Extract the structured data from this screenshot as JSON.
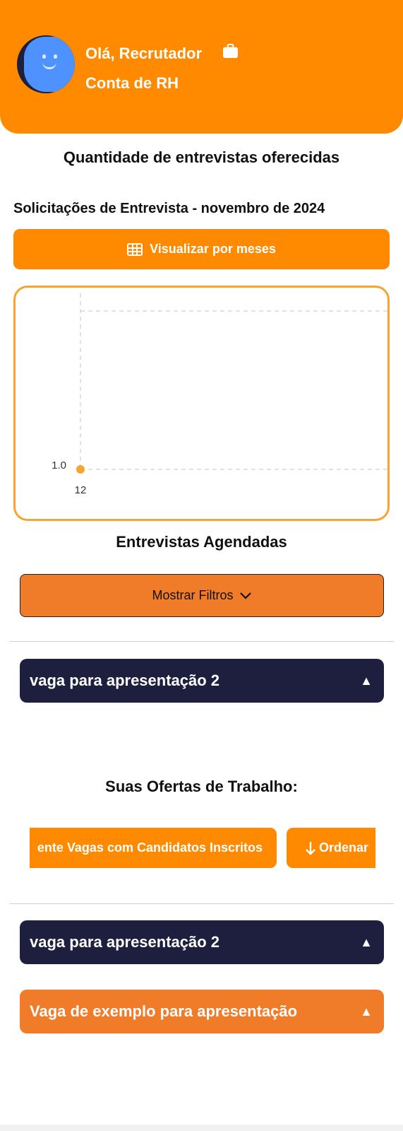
{
  "header": {
    "greeting": "Olá, Recrutador",
    "account": "Conta de RH",
    "icons": [
      "avatar",
      "briefcase-icon"
    ]
  },
  "section_interview_count": {
    "title": "Quantidade de entrevistas oferecidas",
    "subtitle": "Solicitações de Entrevista - novembro de 2024",
    "view_by_month_label": "Visualizar por meses"
  },
  "chart_data": {
    "type": "line",
    "x": [
      12
    ],
    "series": [
      {
        "values": [
          1.0
        ]
      }
    ],
    "y_tick_labels": [
      "1.0"
    ],
    "x_tick_labels": [
      "12"
    ],
    "grid": true,
    "colors": {
      "point": "#f7a531",
      "border": "#f7a531"
    }
  },
  "section_scheduled": {
    "title": "Entrevistas Agendadas",
    "filters_button": "Mostrar Filtros",
    "accordion": [
      {
        "label": "vaga para apresentação 2",
        "arrow": "▲"
      }
    ]
  },
  "section_offers": {
    "title": "Suas Ofertas de Trabalho:",
    "filter_chip": "ente Vagas com Candidatos Inscritos",
    "sort_chip": "Ordenar",
    "accordions": [
      {
        "label": "vaga para apresentação 2",
        "arrow": "▲"
      },
      {
        "label": "Vaga de exemplo para apresentação",
        "arrow": "▲"
      }
    ]
  },
  "colors": {
    "primary_orange": "#ff8a00",
    "secondary_orange": "#f07b29",
    "dark_navy": "#1e1f3f"
  }
}
